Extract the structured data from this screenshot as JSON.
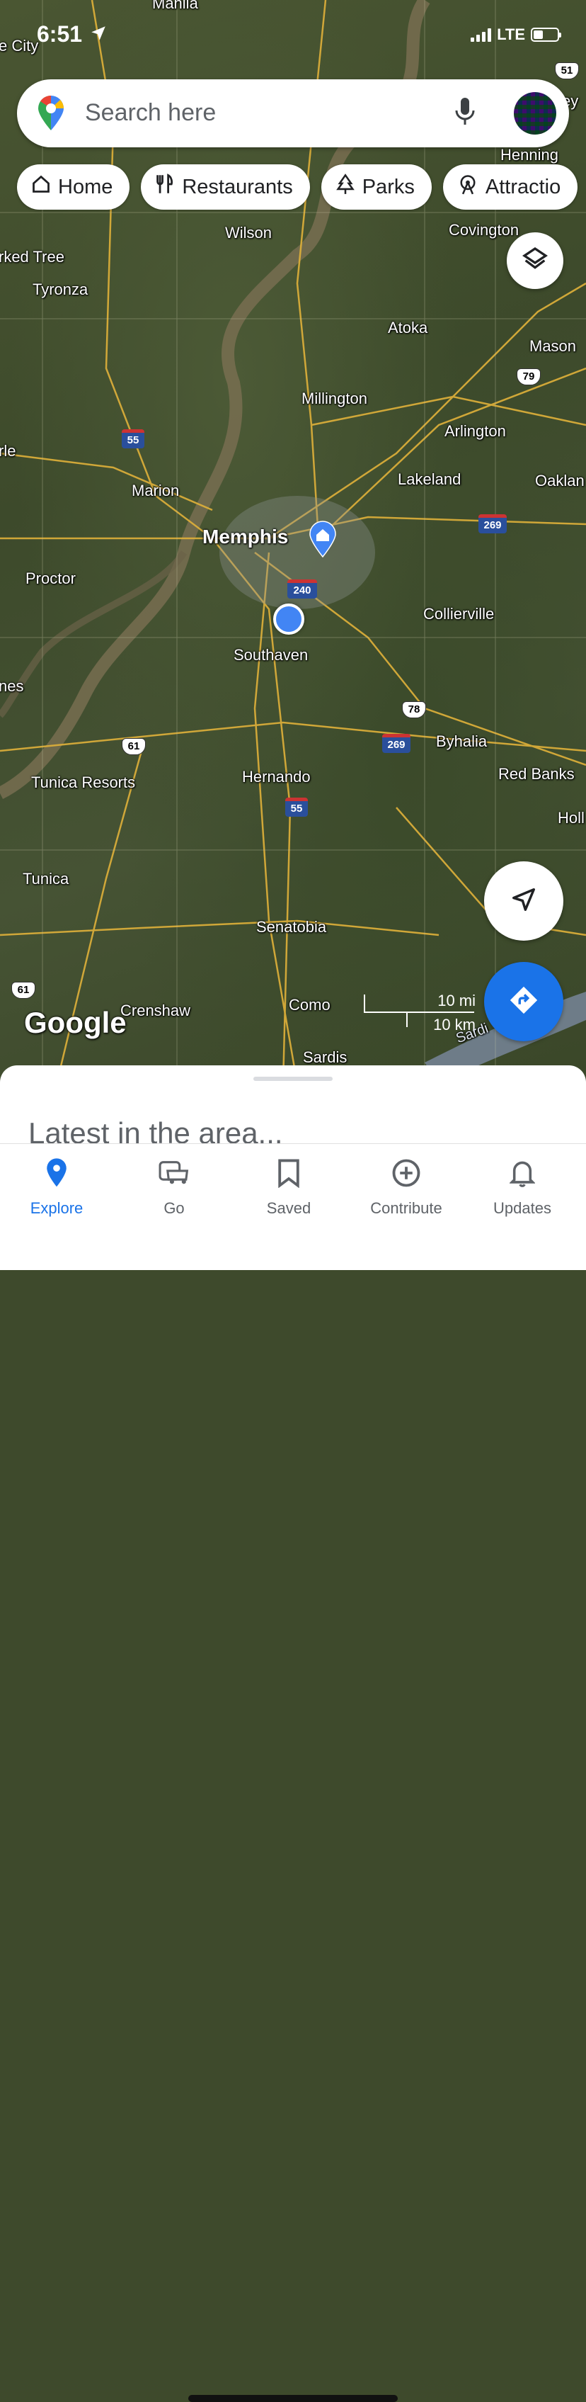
{
  "status_bar": {
    "time": "6:51",
    "network": "LTE"
  },
  "search": {
    "placeholder": "Search here"
  },
  "chips": [
    {
      "label": "Home",
      "icon": "home-icon"
    },
    {
      "label": "Restaurants",
      "icon": "fork-knife-icon"
    },
    {
      "label": "Parks",
      "icon": "tree-icon"
    },
    {
      "label": "Attractio",
      "icon": "ferris-wheel-icon"
    }
  ],
  "map": {
    "places": {
      "manila": "Manila",
      "city": "e City",
      "wilson": "Wilson",
      "marked_tree": "rked Tree",
      "tyronza": "Tyronza",
      "henning": "Henning",
      "covington": "Covington",
      "atoka": "Atoka",
      "mason": "Mason",
      "millington": "Millington",
      "arlington": "Arlington",
      "lakeland": "Lakeland",
      "oakland": "Oaklan",
      "marion": "Marion",
      "memphis": "Memphis",
      "proctor": "Proctor",
      "southaven": "Southaven",
      "collierville": "Collierville",
      "byhalia": "Byhalia",
      "red_banks": "Red Banks",
      "holly": "Holl",
      "hernando": "Hernando",
      "tunica_resorts": "Tunica Resorts",
      "tunica": "Tunica",
      "senatobia": "Senatobia",
      "crenshaw": "Crenshaw",
      "como": "Como",
      "sardis": "Sardis",
      "sardis_lake": "Sardi",
      "erle": "rle",
      "nes": "nes",
      "ey": "ey"
    },
    "shields": {
      "us51": "51",
      "i55_north": "55",
      "us79": "79",
      "i269_east": "269",
      "i240": "240",
      "us78": "78",
      "i269_south": "269",
      "us61": "61",
      "i55_south": "55",
      "us61_south": "61"
    },
    "google_logo": "Google",
    "scale_miles": "10 mi",
    "scale_km": "10 km"
  },
  "sheet": {
    "title": "Latest in the area..."
  },
  "nav": [
    {
      "label": "Explore",
      "icon": "explore-pin-icon",
      "active": true
    },
    {
      "label": "Go",
      "icon": "car-icon",
      "active": false
    },
    {
      "label": "Saved",
      "icon": "bookmark-icon",
      "active": false
    },
    {
      "label": "Contribute",
      "icon": "plus-circle-icon",
      "active": false
    },
    {
      "label": "Updates",
      "icon": "bell-icon",
      "active": false
    }
  ],
  "colors": {
    "accent": "#1a73e8",
    "location_dot": "#4285f4"
  }
}
